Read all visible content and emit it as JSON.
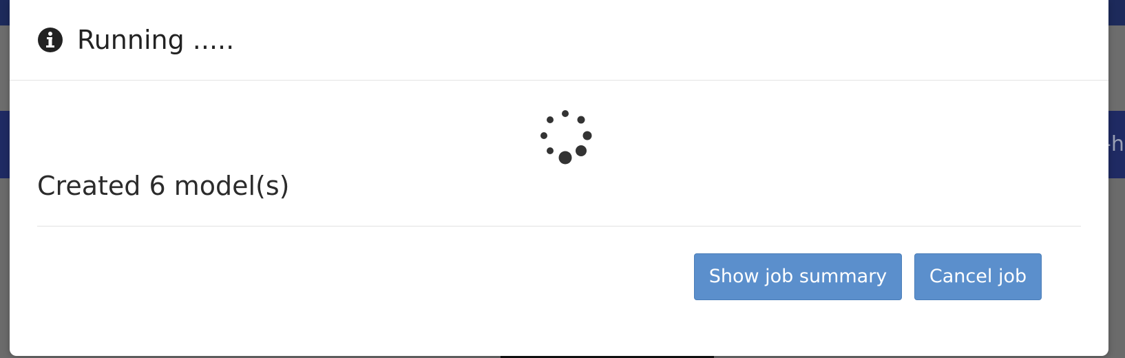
{
  "modal": {
    "title": "Running .....",
    "status_text": "Created 6 model(s)",
    "buttons": {
      "show_summary_label": "Show job summary",
      "cancel_label": "Cancel job"
    }
  },
  "background": {
    "partial_text": "-h"
  },
  "colors": {
    "primary_button": "#5b8fcc",
    "navbar": "#1f2a63",
    "overlay": "#6d6d6d",
    "text": "#2b2b2b"
  },
  "icons": {
    "title_icon": "info-circle-icon",
    "loading_icon": "loading-spinner-icon"
  }
}
